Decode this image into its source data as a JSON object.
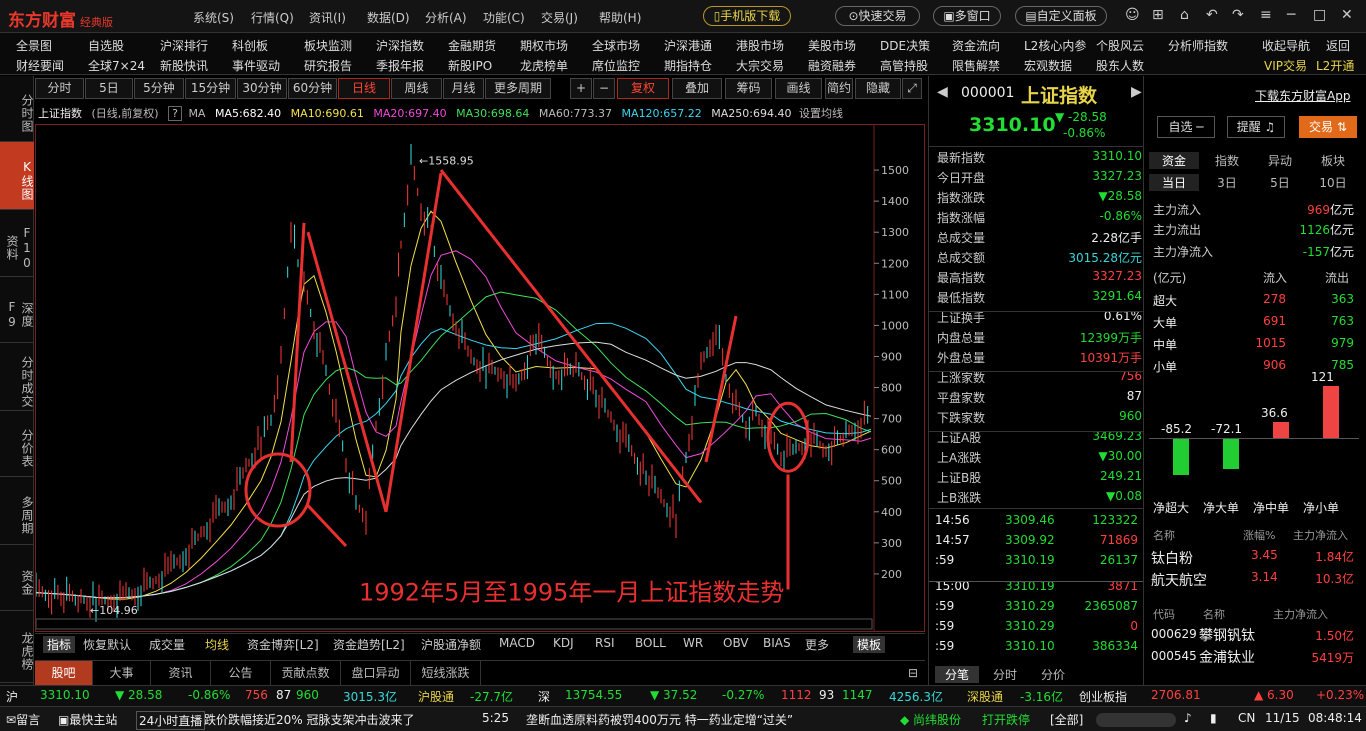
{
  "titlebar": {
    "logo": "东方财富",
    "edition": "经典版",
    "menus": [
      "系统(S)",
      "行情(Q)",
      "资讯(I)",
      "数据(D)",
      "分析(A)",
      "功能(C)",
      "交易(J)",
      "帮助(H)"
    ],
    "mobile_btn": "手机版下载",
    "quick_trade": "快速交易",
    "multi_window": "多窗口",
    "custom_panel": "自定义面板"
  },
  "navbar": {
    "row1": [
      "全景图",
      "自选股",
      "沪深排行",
      "科创板",
      "板块监测",
      "沪深指数",
      "金融期货",
      "期权市场",
      "全球市场",
      "沪深港通",
      "港股市场",
      "美股市场",
      "DDE决策",
      "资金流向",
      "L2核心内参",
      "个股风云",
      "分析师指数",
      "收起导航",
      "返回"
    ],
    "row2": [
      "财经要闻",
      "全球7×24",
      "新股快讯",
      "事件驱动",
      "研究报告",
      "季报年报",
      "新股IPO",
      "龙虎榜单",
      "席位监控",
      "期指持仓",
      "大宗交易",
      "融资融券",
      "高管持股",
      "限售解禁",
      "宏观数据",
      "股东人数",
      "VIP交易",
      "L2开通"
    ]
  },
  "side_tabs": [
    "分时图",
    "K线图",
    "F10资料",
    "深度F9",
    "分时成交",
    "分价表",
    "多周期",
    "资金",
    "龙虎榜"
  ],
  "chart_toolbar": {
    "periods": [
      "分时",
      "5日",
      "5分钟",
      "15分钟",
      "30分钟",
      "60分钟",
      "日线",
      "周线",
      "月线",
      "更多周期"
    ],
    "right": [
      "复权",
      "叠加",
      "筹码",
      "画线",
      "简约",
      "隐藏"
    ]
  },
  "ma_line": {
    "name": "上证指数",
    "mode": "(日线,前复权)",
    "ma_label": "MA",
    "ma5": "MA5:682.40",
    "ma10": "MA10:690.61",
    "ma20": "MA20:697.40",
    "ma30": "MA30:698.64",
    "ma60": "MA60:773.37",
    "ma120": "MA120:657.22",
    "ma250": "MA250:694.40",
    "settings": "设置均线"
  },
  "chart_data": {
    "type": "line",
    "title": "上证指数",
    "ylim": [
      100,
      1600
    ],
    "y_ticks": [
      200,
      300,
      400,
      500,
      600,
      700,
      800,
      900,
      1000,
      1100,
      1200,
      1300,
      1400,
      1500
    ],
    "high_label": "1558.95",
    "low_label": "104.96",
    "annotation": "1992年5月至1995年一月上证指数走势",
    "x": [
      0,
      25,
      45,
      60,
      75,
      90,
      105,
      120,
      135,
      150,
      165,
      180,
      195,
      210,
      225,
      235,
      245,
      255,
      262,
      268,
      278,
      290,
      300,
      310,
      320,
      330,
      340,
      350,
      360,
      365,
      375,
      385,
      395,
      405,
      420,
      435,
      450,
      465,
      480,
      500,
      520,
      540,
      560,
      575,
      590,
      610,
      625,
      640,
      650,
      665,
      680,
      690,
      700,
      710,
      720,
      735,
      745,
      760,
      775,
      790,
      810,
      825,
      835
    ],
    "values": [
      140,
      130,
      118,
      110,
      118,
      130,
      150,
      180,
      220,
      270,
      330,
      390,
      440,
      540,
      630,
      700,
      890,
      1320,
      1200,
      1120,
      1000,
      850,
      700,
      560,
      420,
      390,
      680,
      900,
      1080,
      1260,
      1530,
      1380,
      1300,
      1130,
      1000,
      890,
      860,
      850,
      800,
      960,
      840,
      860,
      780,
      700,
      620,
      520,
      440,
      380,
      580,
      870,
      990,
      830,
      740,
      680,
      720,
      630,
      580,
      600,
      640,
      600,
      650,
      690,
      700
    ]
  },
  "indicators": [
    "指标",
    "恢复默认",
    "成交量",
    "均线",
    "资金博弈[L2]",
    "资金趋势[L2]",
    "沪股通净额",
    "MACD",
    "KDJ",
    "RSI",
    "BOLL",
    "WR",
    "OBV",
    "BIAS",
    "更多",
    "模板"
  ],
  "bottom_tabs": [
    "股吧",
    "大事",
    "资讯",
    "公告",
    "贡献点数",
    "盘口异动",
    "短线涨跌"
  ],
  "quote": {
    "code": "000001",
    "name": "上证指数",
    "download": "下载东方财富App",
    "price": "3310.10",
    "chg": "-28.58",
    "pct": "-0.86%",
    "btn_fav": "自选 ─",
    "btn_alert": "提醒",
    "btn_trade": "交易",
    "rows": [
      [
        "最新指数",
        "3310.10"
      ],
      [
        "今日开盘",
        "3327.23"
      ],
      [
        "指数涨跌",
        "▼28.58"
      ],
      [
        "指数涨幅",
        "-0.86%"
      ],
      [
        "总成交量",
        "2.28亿手"
      ],
      [
        "总成交额",
        "3015.28亿元"
      ],
      [
        "最高指数",
        "3327.23"
      ],
      [
        "最低指数",
        "3291.64"
      ],
      [
        "上证换手",
        "0.61%"
      ],
      [
        "内盘总量",
        "12399万手"
      ],
      [
        "外盘总量",
        "10391万手"
      ],
      [
        "上涨家数",
        "756"
      ],
      [
        "平盘家数",
        "87"
      ],
      [
        "下跌家数",
        "960"
      ],
      [
        "上证A股",
        "3469.23"
      ],
      [
        "上A涨跌",
        "▼30.00"
      ],
      [
        "上证B股",
        "249.21"
      ],
      [
        "上B涨跌",
        "▼0.08"
      ]
    ],
    "ticks": [
      [
        "14:56",
        "3309.46",
        "123322"
      ],
      [
        "14:57",
        "3309.92",
        "71869"
      ],
      [
        ":59",
        "3310.19",
        "26137"
      ],
      [
        "15:00",
        "3310.19",
        "3871"
      ],
      [
        ":59",
        "3310.29",
        "2365087"
      ],
      [
        ":59",
        "3310.29",
        "0"
      ],
      [
        ":59",
        "3310.10",
        "386334"
      ]
    ],
    "tick_tabs": [
      "分笔",
      "分时",
      "分价"
    ]
  },
  "fund": {
    "tabs": [
      "资金",
      "指数",
      "异动",
      "板块"
    ],
    "periods": [
      "当日",
      "3日",
      "5日",
      "10日"
    ],
    "inflow": [
      "主力流入",
      "969",
      "亿元"
    ],
    "outflow": [
      "主力流出",
      "1126",
      "亿元"
    ],
    "net": [
      "主力净流入",
      "-157",
      "亿元"
    ],
    "head": [
      "(亿元)",
      "流入",
      "流出"
    ],
    "rows": [
      [
        "超大",
        "278",
        "363"
      ],
      [
        "大单",
        "691",
        "763"
      ],
      [
        "中单",
        "1015",
        "979"
      ],
      [
        "小单",
        "906",
        "785"
      ]
    ],
    "bars": [
      [
        "净超大",
        "-85.2"
      ],
      [
        "净大单",
        "-72.1"
      ],
      [
        "净中单",
        "36.6"
      ],
      [
        "净小单",
        "121"
      ]
    ],
    "stocks_head": [
      "名称",
      "涨幅%",
      "主力净流入"
    ],
    "stocks": [
      [
        "钛白粉",
        "3.45",
        "1.84亿"
      ],
      [
        "航天航空",
        "3.14",
        "10.3亿"
      ]
    ],
    "stocks2_head": [
      "代码",
      "名称",
      "主力净流入"
    ],
    "stocks2": [
      [
        "000629",
        "攀钢钒钛",
        "1.50亿"
      ],
      [
        "000545",
        "金浦钛业",
        "5419万"
      ]
    ]
  },
  "status": {
    "sh": "沪",
    "sh_price": "3310.10",
    "sh_chg": "▼ 28.58",
    "sh_pct": "-0.86%",
    "sh_up": "756",
    "sh_flat": "87",
    "sh_down": "960",
    "sh_amt": "3015.3亿",
    "hgt": "沪股通",
    "hgt_v": "-27.7亿",
    "sz": "深",
    "sz_price": "13754.55",
    "sz_chg": "▼ 37.52",
    "sz_pct": "-0.27%",
    "sz_up": "1112",
    "sz_flat": "93",
    "sz_down": "1147",
    "sz_amt": "4256.3亿",
    "sgt": "深股通",
    "sgt_v": "-3.16亿",
    "cyb": "创业板指",
    "cyb_price": "2706.81",
    "cyb_chg": "▲ 6.30",
    "cyb_pct": "+0.23%"
  },
  "ticker": {
    "msg": "留言",
    "kuaijie": "最快主站",
    "live": "24小时直播",
    "news1": "跌价跌幅接近20% 冠脉支架冲击波来了",
    "time1": "5:25",
    "news2": "垄断血透原料药被罚400万元 特一药业定增“过关”",
    "hot": "◆ 尚纬股份",
    "open": "打开跌停",
    "all": "[全部]",
    "lang": "CN",
    "date": "11/15",
    "clock": "08:48:14"
  }
}
